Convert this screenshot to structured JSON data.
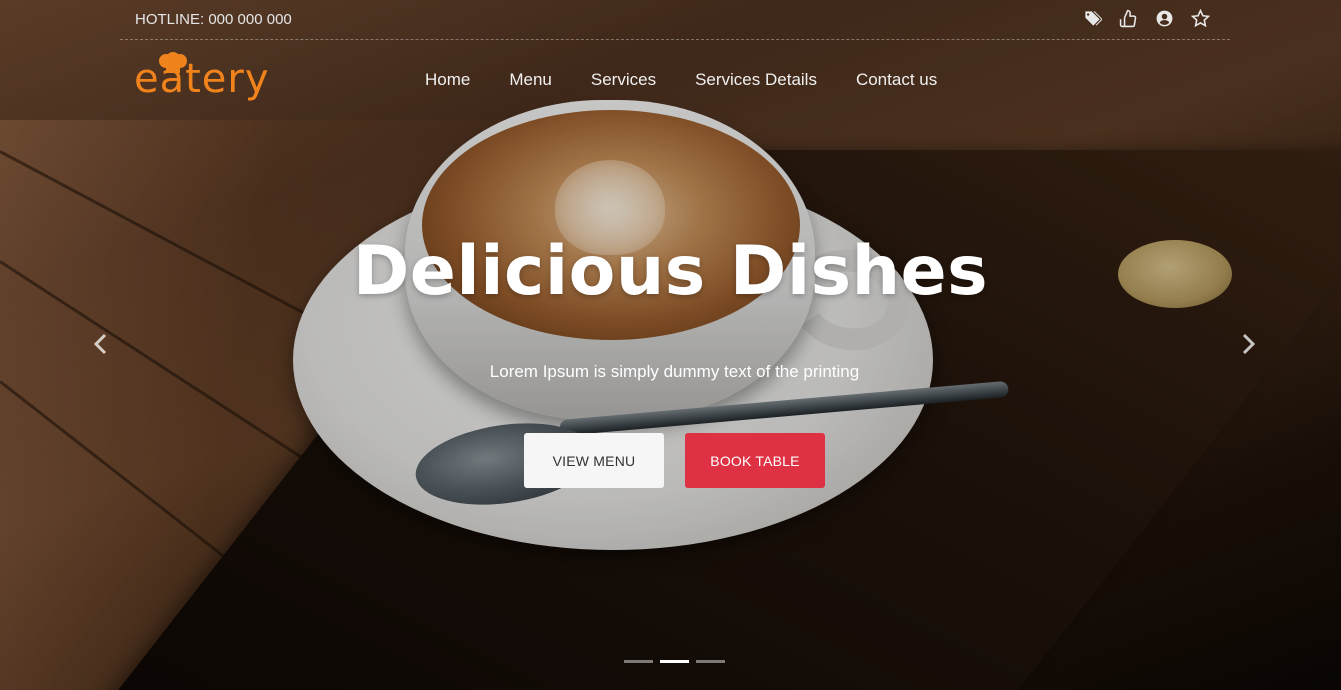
{
  "topbar": {
    "hotline": "HOTLINE: 000 000 000",
    "icons": [
      "tags-icon",
      "thumbs-up-icon",
      "user-circle-icon",
      "star-icon"
    ]
  },
  "logo": {
    "text": "eatery",
    "color": "#f1831c"
  },
  "nav": {
    "items": [
      {
        "label": "Home"
      },
      {
        "label": "Menu"
      },
      {
        "label": "Services"
      },
      {
        "label": "Services Details"
      },
      {
        "label": "Contact us"
      }
    ]
  },
  "hero": {
    "title": "Delicious Dishes",
    "subtitle": "Lorem Ipsum is simply dummy text of the printing",
    "buttons": {
      "view_menu": "VIEW MENU",
      "book_table": "BOOK TABLE"
    },
    "book_color": "#de3143"
  },
  "carousel": {
    "slides": 3,
    "active_slide": 2
  }
}
